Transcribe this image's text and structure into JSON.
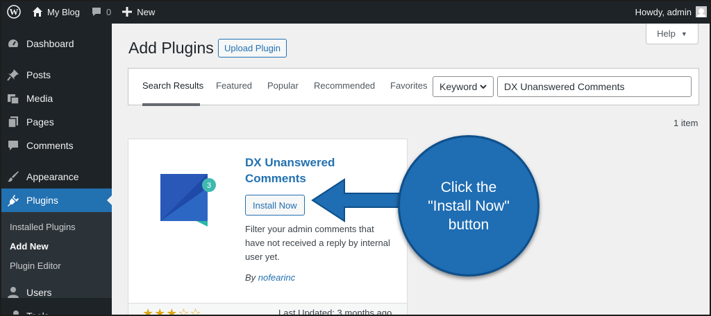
{
  "admin_bar": {
    "site_name": "My Blog",
    "comments_count": "0",
    "new_label": "New",
    "greeting": "Howdy, admin"
  },
  "sidebar": {
    "items": [
      {
        "label": "Dashboard",
        "icon": "dashboard-icon"
      },
      {
        "label": "Posts",
        "icon": "pin-icon"
      },
      {
        "label": "Media",
        "icon": "media-icon"
      },
      {
        "label": "Pages",
        "icon": "pages-icon"
      },
      {
        "label": "Comments",
        "icon": "comment-icon"
      },
      {
        "label": "Appearance",
        "icon": "brush-icon"
      },
      {
        "label": "Plugins",
        "icon": "plug-icon"
      },
      {
        "label": "Users",
        "icon": "users-icon"
      },
      {
        "label": "Tools",
        "icon": "tools-icon"
      }
    ],
    "submenu": [
      {
        "label": "Installed Plugins"
      },
      {
        "label": "Add New"
      },
      {
        "label": "Plugin Editor"
      }
    ]
  },
  "help_label": "Help",
  "page": {
    "title": "Add Plugins",
    "upload_label": "Upload Plugin"
  },
  "filter": {
    "tabs": [
      "Search Results",
      "Featured",
      "Popular",
      "Recommended",
      "Favorites"
    ],
    "search_type": "Keyword",
    "search_value": "DX Unanswered Comments"
  },
  "results_count": "1 item",
  "plugin": {
    "name_line1": "DX Unanswered",
    "name_line2": "Comments",
    "install_label": "Install Now",
    "description": "Filter your admin comments that have not received a reply by internal user yet.",
    "author_prefix": "By ",
    "author": "nofearinc",
    "badge_count": "3",
    "last_updated": "Last Updated: 3 months ago",
    "rating_stars": 3
  },
  "callout": {
    "line1": "Click the",
    "line2": "\"Install Now\"",
    "line3": "button"
  },
  "colors": {
    "admin_dark": "#1d2327",
    "wp_blue": "#2271b1",
    "callout_blue": "#1f6db3"
  }
}
